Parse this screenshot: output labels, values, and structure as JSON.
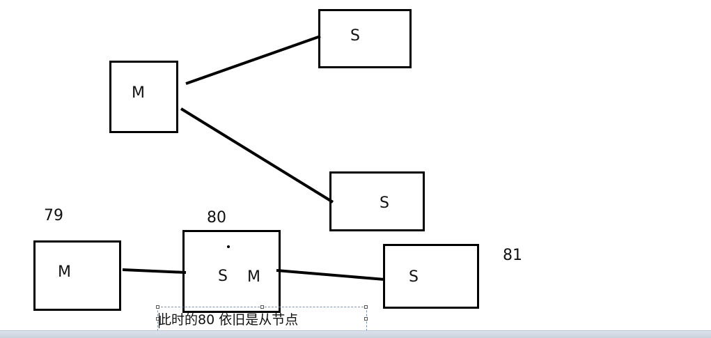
{
  "diagram": {
    "top": {
      "master": {
        "label": "M"
      },
      "slave_1": {
        "label": "S"
      },
      "slave_2": {
        "label": "S"
      }
    },
    "bottom": {
      "node_79": {
        "number": "79",
        "label": "M"
      },
      "node_80": {
        "number": "80",
        "label_s": "S",
        "label_m": "M"
      },
      "node_81": {
        "number": "81",
        "label": "S"
      }
    },
    "textbox": {
      "text": "此时的80 依旧是从节点"
    }
  },
  "colors": {
    "stroke": "#000000",
    "textbox_border": "#7a93b8",
    "bottom_bar": "#c7d0dd"
  }
}
